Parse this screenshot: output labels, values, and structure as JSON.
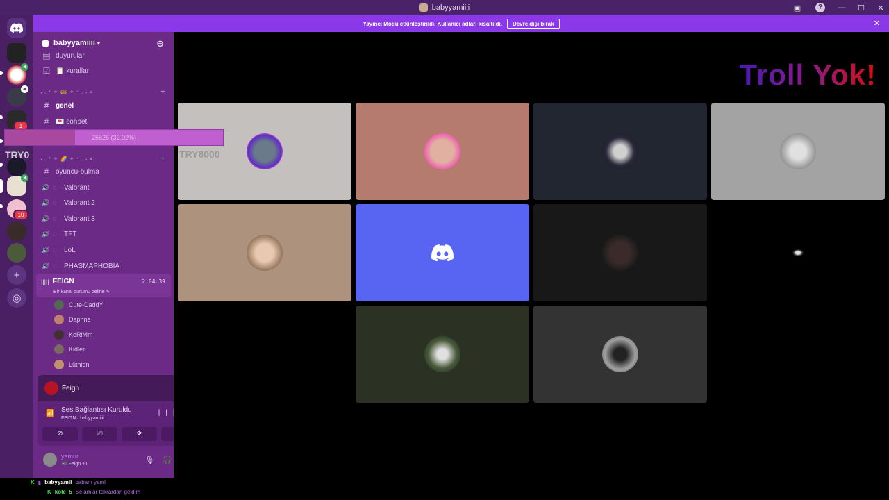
{
  "window": {
    "title": "babyyamiiii"
  },
  "banner": {
    "text": "Yayıncı Modu etkinleştirildi. Kullanıcı adları kısaltıldı.",
    "button_label": "Devre dışı bırak",
    "color": "#8a38e8"
  },
  "server": {
    "name": "babyyamiiii",
    "channels": [
      {
        "name": "duyurular",
        "type": "text"
      },
      {
        "name": "📋 kurallar",
        "type": "text"
      },
      {
        "name": "genel",
        "type": "text",
        "active": true
      },
      {
        "name": "💌 sohbet",
        "type": "text"
      },
      {
        "name": "oyuncu-bulma",
        "type": "text"
      },
      {
        "name": "Valorant",
        "type": "voice"
      },
      {
        "name": "Valorant 2",
        "type": "voice"
      },
      {
        "name": "Valorant 3",
        "type": "voice"
      },
      {
        "name": "TFT",
        "type": "voice"
      },
      {
        "name": "LoL",
        "type": "voice"
      },
      {
        "name": "PHASMAPHOBIA",
        "type": "voice"
      }
    ],
    "categories": [
      "˖ . ⁺ ✧ 🍩 ✧ ⁺ . ˖",
      "˖ . ⁺ ✧ 🌈 ✧ ⁺ . ˖"
    ],
    "current_voice": {
      "name": "FEIGN",
      "timer": "2:04:39",
      "status": "Bir kanal durumu belirle",
      "members": [
        "Cute-DaddY",
        "Daphne",
        "KeRiMm",
        "Kidler",
        "Lüthien"
      ]
    }
  },
  "guild_badges": {
    "mention_1": "1",
    "mention_10": "10"
  },
  "overlay": {
    "progress_text": "25626 (32.02%)",
    "progress_fraction": 0.3202,
    "left_label": "TRY0",
    "tile_label": "TRY8000"
  },
  "voice_panel": {
    "name": "Feign",
    "connection_title": "Ses Bağlantısı Kuruldu",
    "connection_sub": "FEIGN / babyyamiiii"
  },
  "user": {
    "name": "yamur",
    "status": "🎮 Feign +1"
  },
  "title_overlay": "Troll Yok!",
  "chat": [
    {
      "user": "babyyamii",
      "message": "babam yami"
    },
    {
      "user": "kole_5",
      "message": "Selamlar tekrardan geldim"
    }
  ],
  "colors": {
    "sidebar": "#6a2a85",
    "guildbar": "#4a1f63",
    "tile_discord": "#5865f2"
  }
}
